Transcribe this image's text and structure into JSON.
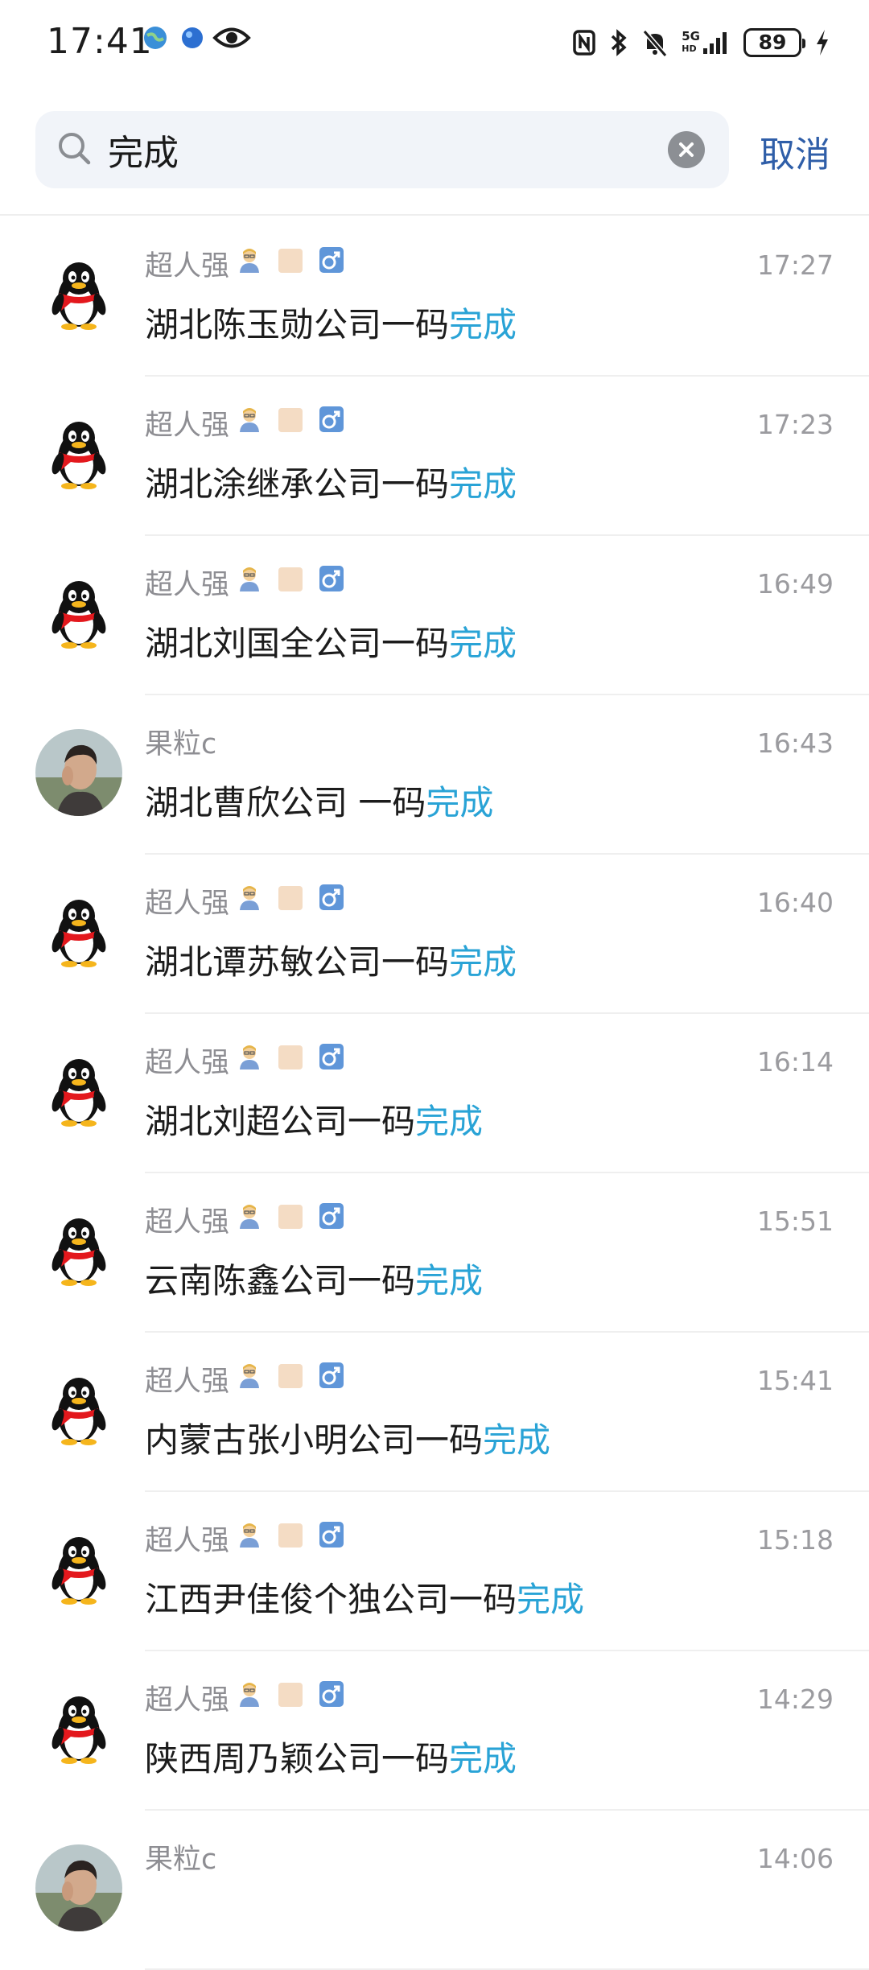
{
  "status_bar": {
    "time": "17:41",
    "network_label_top": "5G",
    "network_label_bottom": "HD",
    "battery": "89"
  },
  "search": {
    "query": "完成",
    "cancel_label": "取消"
  },
  "colors": {
    "highlight": "#29a3d6",
    "cancel": "#2f5ea8",
    "search_bg": "#f1f4f9"
  },
  "results": [
    {
      "sender": "超人强",
      "time": "17:27",
      "msg_before": "湖北陈玉勋公司一码",
      "msg_highlight": "完成",
      "avatar": "qq-penguin-icon"
    },
    {
      "sender": "超人强",
      "time": "17:23",
      "msg_before": "湖北涂继承公司一码",
      "msg_highlight": "完成",
      "avatar": "qq-penguin-icon"
    },
    {
      "sender": "超人强",
      "time": "16:49",
      "msg_before": "湖北刘国全公司一码",
      "msg_highlight": "完成",
      "avatar": "qq-penguin-icon"
    },
    {
      "sender": "果粒c",
      "time": "16:43",
      "msg_before": "湖北曹欣公司 一码",
      "msg_highlight": "完成",
      "avatar": "photo-avatar"
    },
    {
      "sender": "超人强",
      "time": "16:40",
      "msg_before": "湖北谭苏敏公司一码",
      "msg_highlight": "完成",
      "avatar": "qq-penguin-icon"
    },
    {
      "sender": "超人强",
      "time": "16:14",
      "msg_before": "湖北刘超公司一码",
      "msg_highlight": "完成",
      "avatar": "qq-penguin-icon"
    },
    {
      "sender": "超人强",
      "time": "15:51",
      "msg_before": "云南陈鑫公司一码",
      "msg_highlight": "完成",
      "avatar": "qq-penguin-icon"
    },
    {
      "sender": "超人强",
      "time": "15:41",
      "msg_before": "内蒙古张小明公司一码",
      "msg_highlight": "完成",
      "avatar": "qq-penguin-icon"
    },
    {
      "sender": "超人强",
      "time": "15:18",
      "msg_before": "江西尹佳俊个独公司一码",
      "msg_highlight": "完成",
      "avatar": "qq-penguin-icon"
    },
    {
      "sender": "超人强",
      "time": "14:29",
      "msg_before": "陕西周乃颖公司一码",
      "msg_highlight": "完成",
      "avatar": "qq-penguin-icon"
    },
    {
      "sender": "果粒c",
      "time": "14:06",
      "msg_before": "",
      "msg_highlight": "",
      "avatar": "photo-avatar"
    }
  ]
}
